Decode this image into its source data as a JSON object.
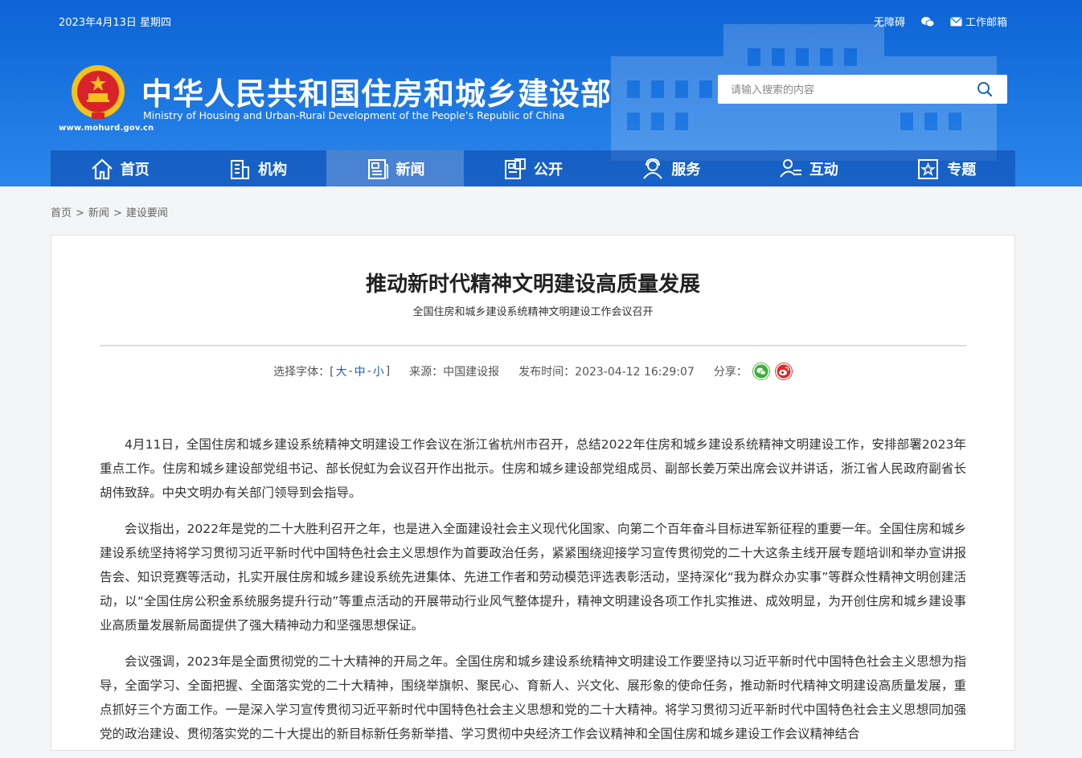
{
  "topbar": {
    "date": "2023年4月13日 星期四",
    "accessibility": "无障碍",
    "wechat_icon": "wechat-icon",
    "email": "工作邮箱"
  },
  "header": {
    "site_url": "www.mohurd.gov.cn",
    "title_cn": "中华人民共和国住房和城乡建设部",
    "title_en": "Ministry of Housing and Urban-Rural Development of the People’s Republic of China",
    "search_placeholder": "请输入搜索的内容"
  },
  "nav": {
    "items": [
      {
        "label": "首页",
        "icon": "home-icon"
      },
      {
        "label": "机构",
        "icon": "building-icon"
      },
      {
        "label": "新闻",
        "icon": "news-icon"
      },
      {
        "label": "公开",
        "icon": "disclosure-icon"
      },
      {
        "label": "服务",
        "icon": "service-icon"
      },
      {
        "label": "互动",
        "icon": "interaction-icon"
      },
      {
        "label": "专题",
        "icon": "topic-icon"
      }
    ],
    "active": "新闻"
  },
  "breadcrumb": [
    "首页",
    "新闻",
    "建设要闻"
  ],
  "article": {
    "title": "推动新时代精神文明建设高质量发展",
    "subtitle": "全国住房和城乡建设系统精神文明建设工作会议召开",
    "font_label": "选择字体：[",
    "font_large": "大",
    "font_medium": "中",
    "font_small": "小",
    "font_close": "]",
    "source": "来源：中国建设报",
    "publish_time": "发布时间：2023-04-12 16:29:07",
    "share_label": "分享：",
    "paragraphs": [
      "4月11日，全国住房和城乡建设系统精神文明建设工作会议在浙江省杭州市召开，总结2022年住房和城乡建设系统精神文明建设工作，安排部署2023年重点工作。住房和城乡建设部党组书记、部长倪虹为会议召开作出批示。住房和城乡建设部党组成员、副部长姜万荣出席会议并讲话，浙江省人民政府副省长胡伟致辞。中央文明办有关部门领导到会指导。",
      "会议指出，2022年是党的二十大胜利召开之年，也是进入全面建设社会主义现代化国家、向第二个百年奋斗目标进军新征程的重要一年。全国住房和城乡建设系统坚持将学习贯彻习近平新时代中国特色社会主义思想作为首要政治任务，紧紧围绕迎接学习宣传贯彻党的二十大这条主线开展专题培训和举办宣讲报告会、知识竞赛等活动，扎实开展住房和城乡建设系统先进集体、先进工作者和劳动模范评选表彰活动，坚持深化“我为群众办实事”等群众性精神文明创建活动，以“全国住房公积金系统服务提升行动”等重点活动的开展带动行业风气整体提升，精神文明建设各项工作扎实推进、成效明显，为开创住房和城乡建设事业高质量发展新局面提供了强大精神动力和坚强思想保证。",
      "会议强调，2023年是全面贯彻党的二十大精神的开局之年。全国住房和城乡建设系统精神文明建设工作要坚持以习近平新时代中国特色社会主义思想为指导，全面学习、全面把握、全面落实党的二十大精神，围绕举旗帜、聚民心、育新人、兴文化、展形象的使命任务，推动新时代精神文明建设高质量发展，重点抓好三个方面工作。一是深入学习宣传贯彻习近平新时代中国特色社会主义思想和党的二十大精神。将学习贯彻习近平新时代中国特色社会主义思想同加强党的政治建设、贯彻落实党的二十大提出的新目标新任务新举措、学习贯彻中央经济工作会议精神和全国住房和城乡建设工作会议精神结合"
    ]
  },
  "colors": {
    "header_blue": "#1a74e0",
    "link_blue": "#1a5fc8",
    "wechat_green": "#3cb034",
    "weibo_red": "#e0282a"
  }
}
